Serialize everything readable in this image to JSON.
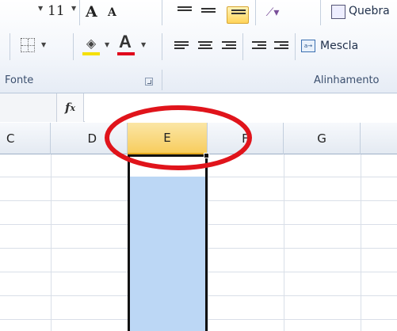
{
  "ribbon": {
    "font_size_value": "11",
    "grow_font_label": "A",
    "shrink_font_label": "A",
    "wrap_text_label": "Quebra",
    "merge_label": "Mescla",
    "merge_icon_text": "a→",
    "font_color_letter": "A",
    "fill_color": "#f5e000",
    "font_color": "#e0001b",
    "groups": {
      "font": "Fonte",
      "alignment": "Alinhamento"
    },
    "icons": [
      "font-size-dropdown-icon",
      "increase-font-icon",
      "decrease-font-icon",
      "align-top-icon",
      "align-middle-icon",
      "align-bottom-icon",
      "orientation-icon",
      "wrap-text-icon",
      "borders-icon",
      "fill-color-icon",
      "font-color-icon",
      "align-left-icon",
      "align-center-icon",
      "align-right-icon",
      "decrease-indent-icon",
      "increase-indent-icon",
      "merge-center-icon",
      "dialog-launcher-icon"
    ]
  },
  "formula_bar": {
    "fx_label": "fx",
    "value": ""
  },
  "grid": {
    "columns": [
      {
        "label": "C",
        "selected": false
      },
      {
        "label": "D",
        "selected": false
      },
      {
        "label": "E",
        "selected": true
      },
      {
        "label": "F",
        "selected": false
      },
      {
        "label": "G",
        "selected": false
      }
    ],
    "selected_column": "E",
    "selection_color": "#bcd7f5",
    "header_highlight_color": "#f7cd5e"
  },
  "annotation": {
    "shape": "ellipse",
    "color": "#e0141b",
    "target": "column-header-E"
  }
}
